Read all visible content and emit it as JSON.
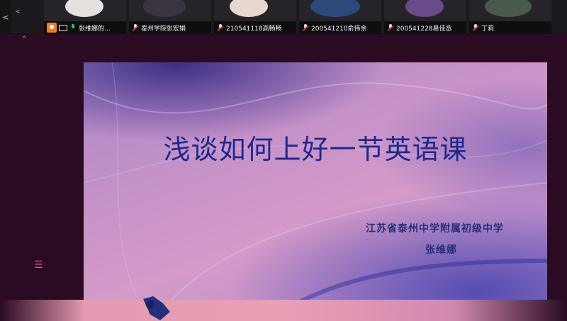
{
  "strip": {
    "nav_left": "<",
    "collapse": "<",
    "participants": [
      {
        "name": "张维娜的...",
        "host": true,
        "screen_share": true,
        "mic_on": true
      },
      {
        "name": "泰州学院张宏娟",
        "host": false,
        "screen_share": false,
        "mic_on": false
      },
      {
        "name": "210541118高畅畅",
        "host": false,
        "screen_share": false,
        "mic_on": false
      },
      {
        "name": "200541210俞伟余",
        "host": false,
        "screen_share": false,
        "mic_on": false
      },
      {
        "name": "200541228易佳丞",
        "host": false,
        "screen_share": false,
        "mic_on": false
      },
      {
        "name": "丁莉",
        "host": false,
        "screen_share": false,
        "mic_on": false
      }
    ]
  },
  "slide": {
    "title": "浅谈如何上好一节英语课",
    "organization": "江苏省泰州中学附属初级中学",
    "author": "张维娜"
  },
  "side": {
    "menu_icon": "☰",
    "up_icon": "^"
  },
  "colors": {
    "background": "#2a0b22",
    "title": "#1c2a8c",
    "host_badge": "#f07b22",
    "mic_on": "#2fc15a",
    "mic_muted": "#e03030"
  }
}
